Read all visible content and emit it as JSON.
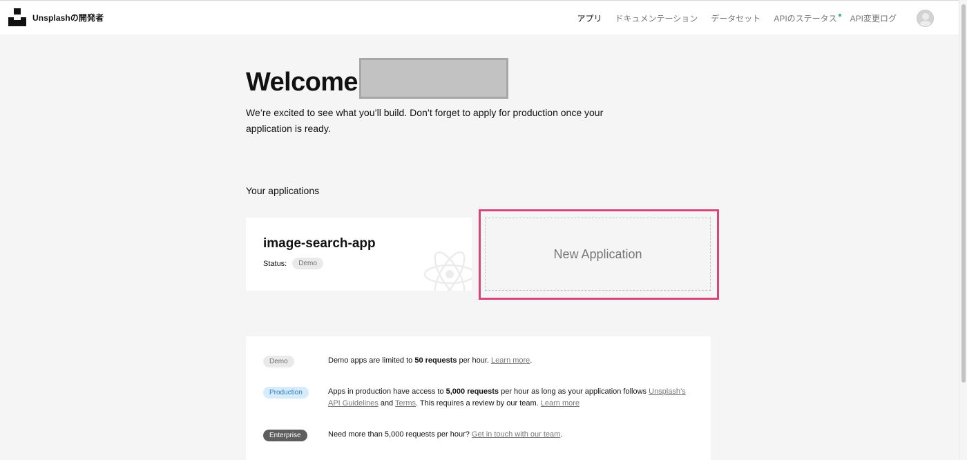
{
  "header": {
    "brand": "Unsplashの開発者",
    "nav": [
      "アプリ",
      "ドキュメンテーション",
      "データセット",
      "APIのステータス",
      "API変更ログ"
    ],
    "active_nav": "アプリ"
  },
  "welcome": {
    "title": "Welcome,",
    "intro": "We’re excited to see what you’ll build. Don’t forget to apply for production once your application is ready."
  },
  "applications": {
    "section_title": "Your applications",
    "items": [
      {
        "name": "image-search-app",
        "status_label": "Status:",
        "status": "Demo",
        "icon": "react-atom-icon"
      }
    ],
    "new_label": "New Application"
  },
  "plans": [
    {
      "badge": "Demo",
      "parts": [
        "Demo apps are limited to ",
        "50 requests",
        " per hour. ",
        "Learn more",
        "."
      ]
    },
    {
      "badge": "Production",
      "parts": [
        "Apps in production have access to ",
        "5,000 requests",
        " per hour as long as your application follows ",
        "Unsplash’s API Guidelines",
        " and ",
        "Terms",
        ". This requires a review by our team. ",
        "Learn more"
      ]
    },
    {
      "badge": "Enterprise",
      "parts": [
        "Need more than 5,000 requests per hour? ",
        "Get in touch with our team",
        "."
      ]
    }
  ],
  "colors": {
    "highlight": "#d9447a",
    "status_dot": "#3cb46e",
    "production_badge_bg": "#d6ebfb",
    "enterprise_badge_bg": "#5e5e5e"
  }
}
